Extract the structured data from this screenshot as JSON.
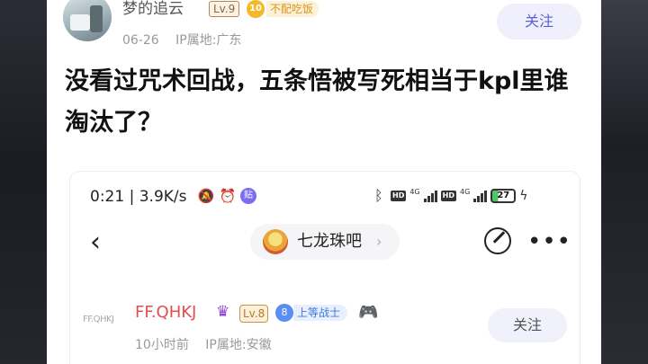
{
  "post": {
    "author": {
      "name": "梦的追云",
      "level": "Lv.9",
      "fan_badge_level": "10",
      "fan_badge_label": "不配吃饭",
      "date": "06-26",
      "ip_location": "IP属地:广东"
    },
    "follow_label": "关注",
    "title": "没看过咒术回战，五条悟被写死相当于kpl里谁淘汰了？"
  },
  "screenshot": {
    "status_bar": {
      "time": "0:21",
      "speed": "3.9K/s",
      "icons": [
        "mute-icon",
        "alarm-icon",
        "app-icon"
      ],
      "network_type": "4G",
      "battery": "27"
    },
    "nav": {
      "back_icon": "chevron-left-icon",
      "forum_name": "七龙珠吧",
      "forum_chevron": "›",
      "edit_icon": "edit-icon",
      "more_icon": "more-icon"
    },
    "reply": {
      "avatar_text": "FF.QHKJ",
      "username": "FF.QHKJ",
      "level": "Lv.8",
      "fan_badge_level": "8",
      "fan_badge_label": "上等战士",
      "time": "10小时前",
      "ip_location": "IP属地:安徽",
      "follow_label": "关注"
    }
  },
  "colors": {
    "accent": "#5b5fd6",
    "fan_badge": "#f3b928",
    "reply_name": "#e34c4c"
  }
}
